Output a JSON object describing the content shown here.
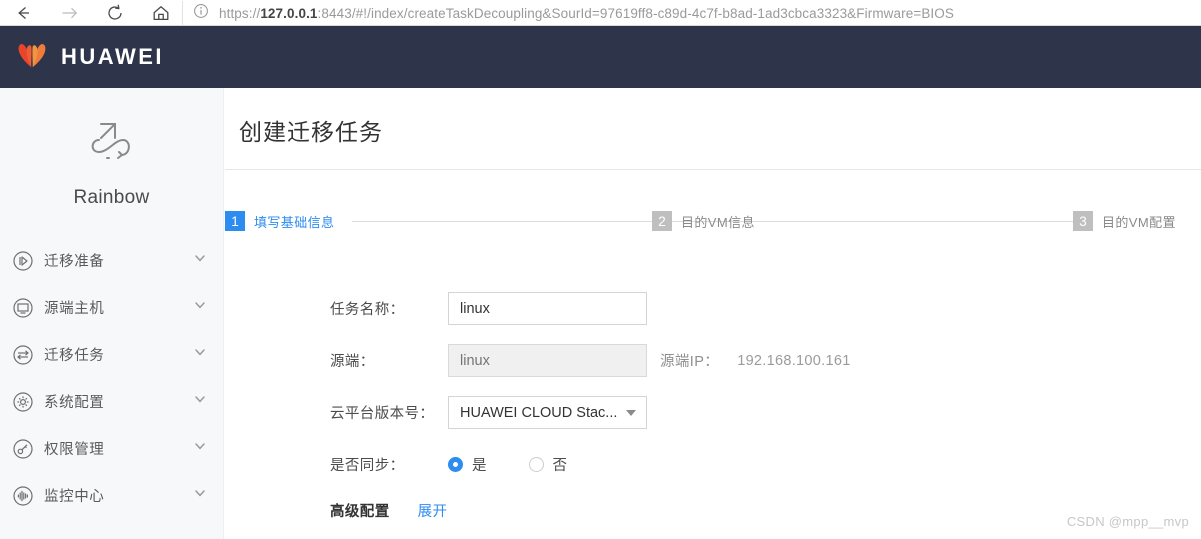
{
  "browser": {
    "back_icon": "arrow-left-icon",
    "forward_icon": "arrow-right-icon",
    "reload_icon": "reload-icon",
    "home_icon": "home-icon",
    "info_icon": "info-icon",
    "url_prefix": "https://",
    "url_host": "127.0.0.1",
    "url_rest": ":8443/#!/index/createTaskDecoupling&SourId=97619ff8-c89d-4c7f-b8ad-1ad3cbca3323&Firmware=BIOS"
  },
  "header": {
    "brand": "HUAWEI",
    "logo_icon": "huawei-flower-logo",
    "background": "#2e3449"
  },
  "sidebar": {
    "product_name": "Rainbow",
    "product_icon": "rainbow-arrow-logo",
    "items": [
      {
        "label": "迁移准备",
        "icon": "play-circle-icon",
        "chevron": "chevron-down-icon"
      },
      {
        "label": "源端主机",
        "icon": "monitor-circle-icon",
        "chevron": "chevron-down-icon"
      },
      {
        "label": "迁移任务",
        "icon": "arrow-exchange-circle-icon",
        "chevron": "chevron-down-icon"
      },
      {
        "label": "系统配置",
        "icon": "gear-circle-icon",
        "chevron": "chevron-down-icon"
      },
      {
        "label": "权限管理",
        "icon": "key-circle-icon",
        "chevron": "chevron-down-icon"
      },
      {
        "label": "监控中心",
        "icon": "pulse-circle-icon",
        "chevron": "chevron-down-icon"
      }
    ]
  },
  "page": {
    "title": "创建迁移任务"
  },
  "stepper": {
    "active_index": 0,
    "accent": "#2d8cf0",
    "steps": [
      {
        "number": "1",
        "label": "填写基础信息"
      },
      {
        "number": "2",
        "label": "目的VM信息"
      },
      {
        "number": "3",
        "label": "目的VM配置"
      }
    ]
  },
  "form": {
    "task_name": {
      "label": "任务名称：",
      "value": "linux",
      "placeholder": ""
    },
    "source": {
      "label": "源端：",
      "value": "",
      "placeholder": "linux",
      "ip_label": "源端IP：",
      "ip_value": "192.168.100.161"
    },
    "cloud_version": {
      "label": "云平台版本号：",
      "value": "HUAWEI CLOUD Stac...",
      "caret_icon": "chevron-down-icon"
    },
    "sync": {
      "label": "是否同步：",
      "options": [
        {
          "text": "是",
          "checked": true
        },
        {
          "text": "否",
          "checked": false
        }
      ]
    },
    "advanced": {
      "title": "高级配置",
      "link": "展开"
    }
  },
  "watermark": {
    "text": "CSDN @mpp__mvp"
  }
}
